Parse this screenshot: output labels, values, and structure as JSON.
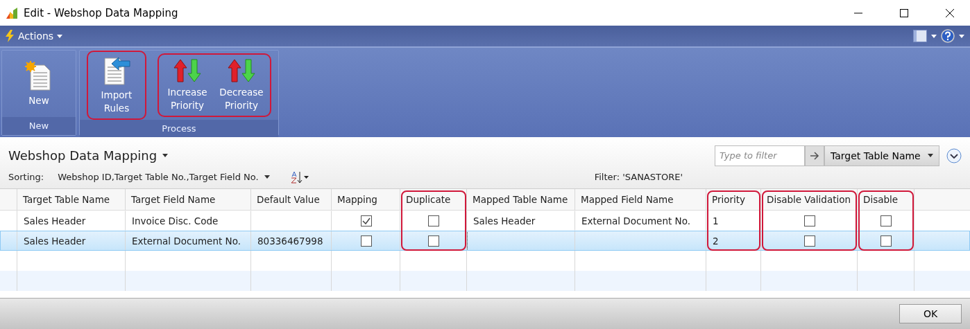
{
  "window": {
    "title": "Edit - Webshop Data Mapping"
  },
  "actions_menu": {
    "label": "Actions"
  },
  "ribbon": {
    "groups": [
      {
        "label": "New",
        "clusters": [
          {
            "highlighted": false,
            "buttons": [
              {
                "label": "New",
                "kind": "new"
              }
            ]
          }
        ]
      },
      {
        "label": "Process",
        "clusters": [
          {
            "highlighted": true,
            "buttons": [
              {
                "label": "Import Rules",
                "kind": "import"
              }
            ]
          },
          {
            "highlighted": true,
            "buttons": [
              {
                "label": "Increase Priority",
                "kind": "priority"
              },
              {
                "label": "Decrease Priority",
                "kind": "priority"
              }
            ]
          }
        ]
      }
    ]
  },
  "page": {
    "title": "Webshop Data Mapping",
    "filter_field": {
      "placeholder": "Type to filter"
    },
    "filter_column": "Target Table Name",
    "sorting_label": "Sorting:",
    "sorting_value": "Webshop ID,Target Table No.,Target Field No.",
    "filter_text": "Filter: 'SANASTORE'"
  },
  "table": {
    "columns": [
      {
        "label": "Target Table Name",
        "highlighted": false
      },
      {
        "label": "Target Field Name",
        "highlighted": false
      },
      {
        "label": "Default Value",
        "highlighted": false
      },
      {
        "label": "Mapping",
        "highlighted": false
      },
      {
        "label": "Duplicate",
        "highlighted": true
      },
      {
        "label": "Mapped Table Name",
        "highlighted": false
      },
      {
        "label": "Mapped Field Name",
        "highlighted": false
      },
      {
        "label": "Priority",
        "highlighted": true
      },
      {
        "label": "Disable Validation",
        "highlighted": true
      },
      {
        "label": "Disable",
        "highlighted": true
      }
    ],
    "rows": [
      {
        "selected": false,
        "cells": [
          {
            "kind": "text",
            "text": "Sales Header",
            "focused": false
          },
          {
            "kind": "text",
            "text": "Invoice Disc. Code",
            "focused": false
          },
          {
            "kind": "text",
            "focused": false
          },
          {
            "kind": "checkbox",
            "checked": true,
            "focused": false
          },
          {
            "kind": "checkbox",
            "checked": false,
            "focused": false
          },
          {
            "kind": "text",
            "text": "Sales Header",
            "focused": false
          },
          {
            "kind": "text",
            "text": "External Document No.",
            "focused": false
          },
          {
            "kind": "text",
            "text": "1",
            "focused": false
          },
          {
            "kind": "checkbox",
            "checked": false,
            "focused": false
          },
          {
            "kind": "checkbox",
            "checked": false,
            "focused": false
          }
        ]
      },
      {
        "selected": true,
        "cells": [
          {
            "kind": "text",
            "text": "Sales Header",
            "focused": false
          },
          {
            "kind": "text",
            "text": "External Document No.",
            "focused": false
          },
          {
            "kind": "text",
            "text": "80336467998",
            "focused": false
          },
          {
            "kind": "checkbox",
            "checked": false,
            "focused": false
          },
          {
            "kind": "checkbox",
            "checked": false,
            "focused": false
          },
          {
            "kind": "text",
            "focused": true
          },
          {
            "kind": "text",
            "focused": false
          },
          {
            "kind": "text",
            "text": "2",
            "focused": false
          },
          {
            "kind": "checkbox",
            "checked": false,
            "focused": false
          },
          {
            "kind": "checkbox",
            "checked": false,
            "focused": false
          }
        ]
      }
    ]
  },
  "buttons": [
    "OK"
  ]
}
